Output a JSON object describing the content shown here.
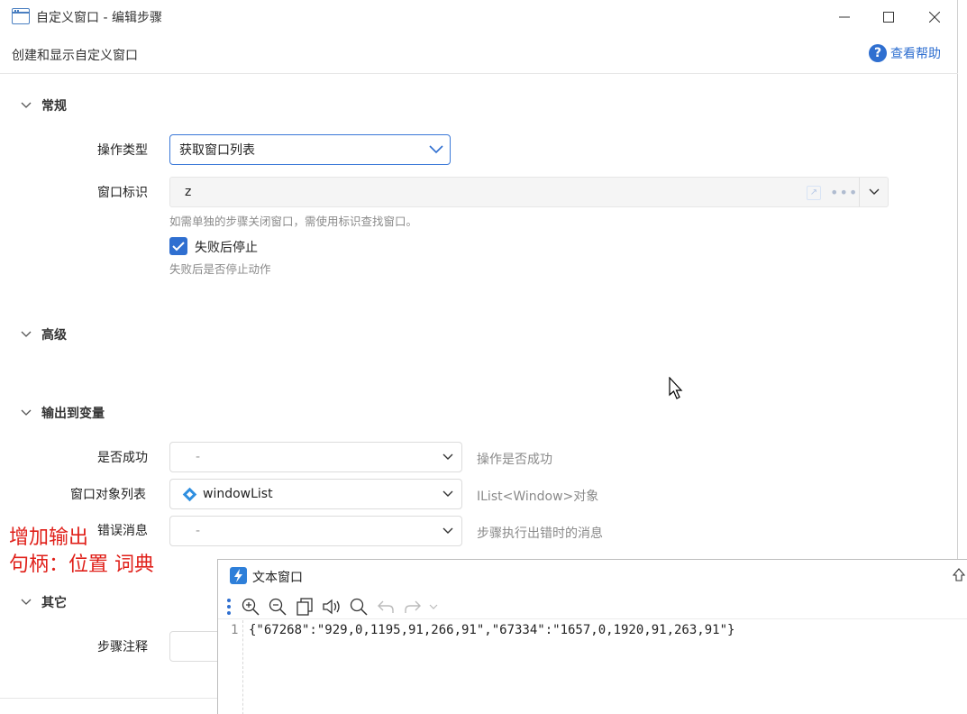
{
  "window": {
    "title": "自定义窗口 - 编辑步骤",
    "subtitle": "创建和显示自定义窗口",
    "help_label": "查看帮助"
  },
  "sections": {
    "general": "常规",
    "advanced": "高级",
    "output": "输出到变量",
    "other": "其它"
  },
  "general": {
    "action_type_label": "操作类型",
    "action_type_value": "获取窗口列表",
    "window_id_label": "窗口标识",
    "window_id_value": "z",
    "window_id_hint": "如需单独的步骤关闭窗口，需使用标识查找窗口。",
    "stop_on_fail_label": "失败后停止",
    "stop_on_fail_checked": true,
    "stop_on_fail_hint": "失败后是否停止动作"
  },
  "output": {
    "success": {
      "label": "是否成功",
      "value": "-",
      "hint": "操作是否成功"
    },
    "window_list": {
      "label": "窗口对象列表",
      "value": "windowList",
      "hint": "IList<Window>对象"
    },
    "error": {
      "label": "错误消息",
      "value": "-",
      "hint": "步骤执行出错时的消息"
    }
  },
  "other": {
    "step_note_label": "步骤注释"
  },
  "annotation": {
    "line1": "增加输出",
    "line2": "句柄：位置 词典"
  },
  "text_window": {
    "title": "文本窗口",
    "line_number": "1",
    "content": "{\"67268\":\"929,0,1195,91,266,91\",\"67334\":\"1657,0,1920,91,263,91\"}"
  },
  "colors": {
    "accent": "#2f6fd0",
    "annotation": "#e0201a"
  }
}
